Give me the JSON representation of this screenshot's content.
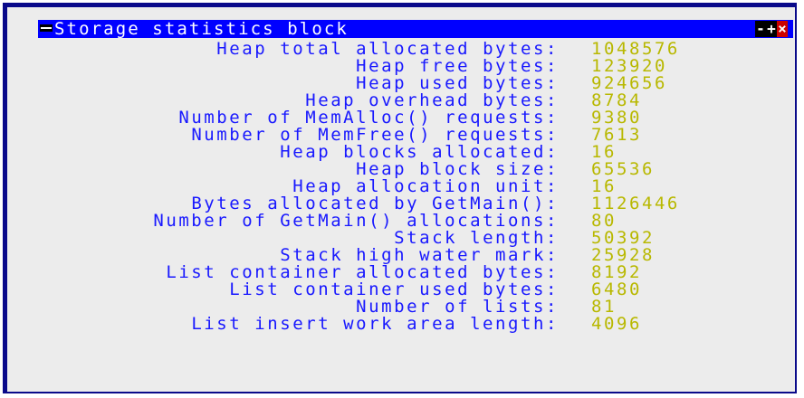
{
  "window": {
    "title": "Storage statistics block",
    "controls": {
      "minimize": "-",
      "maximize": "+",
      "close": "×"
    }
  },
  "stats": [
    {
      "label": "Heap total allocated bytes:",
      "value": "1048576"
    },
    {
      "label": "Heap free bytes:",
      "value": "123920"
    },
    {
      "label": "Heap used bytes:",
      "value": "924656"
    },
    {
      "label": "Heap overhead bytes:",
      "value": "8784"
    },
    {
      "label": "Number of MemAlloc() requests:",
      "value": "9380"
    },
    {
      "label": "Number of MemFree() requests:",
      "value": "7613"
    },
    {
      "label": "Heap blocks allocated:",
      "value": "16"
    },
    {
      "label": "Heap block size:",
      "value": "65536"
    },
    {
      "label": "Heap allocation unit:",
      "value": "16"
    },
    {
      "label": "Bytes allocated by GetMain():",
      "value": "1126446"
    },
    {
      "label": "Number of GetMain() allocations:",
      "value": "80"
    },
    {
      "label": "Stack length:",
      "value": "50392"
    },
    {
      "label": "Stack high water mark:",
      "value": "25928"
    },
    {
      "label": "List container allocated bytes:",
      "value": "8192"
    },
    {
      "label": "List container used bytes:",
      "value": "6480"
    },
    {
      "label": "Number of lists:",
      "value": "81"
    },
    {
      "label": "List insert work area length:",
      "value": "4096"
    }
  ],
  "colors": {
    "frame": "#0a0a8a",
    "titlebar": "#0000ff",
    "label": "#1818ff",
    "value": "#b8b800",
    "background": "#ececec",
    "close": "#cc0000"
  }
}
